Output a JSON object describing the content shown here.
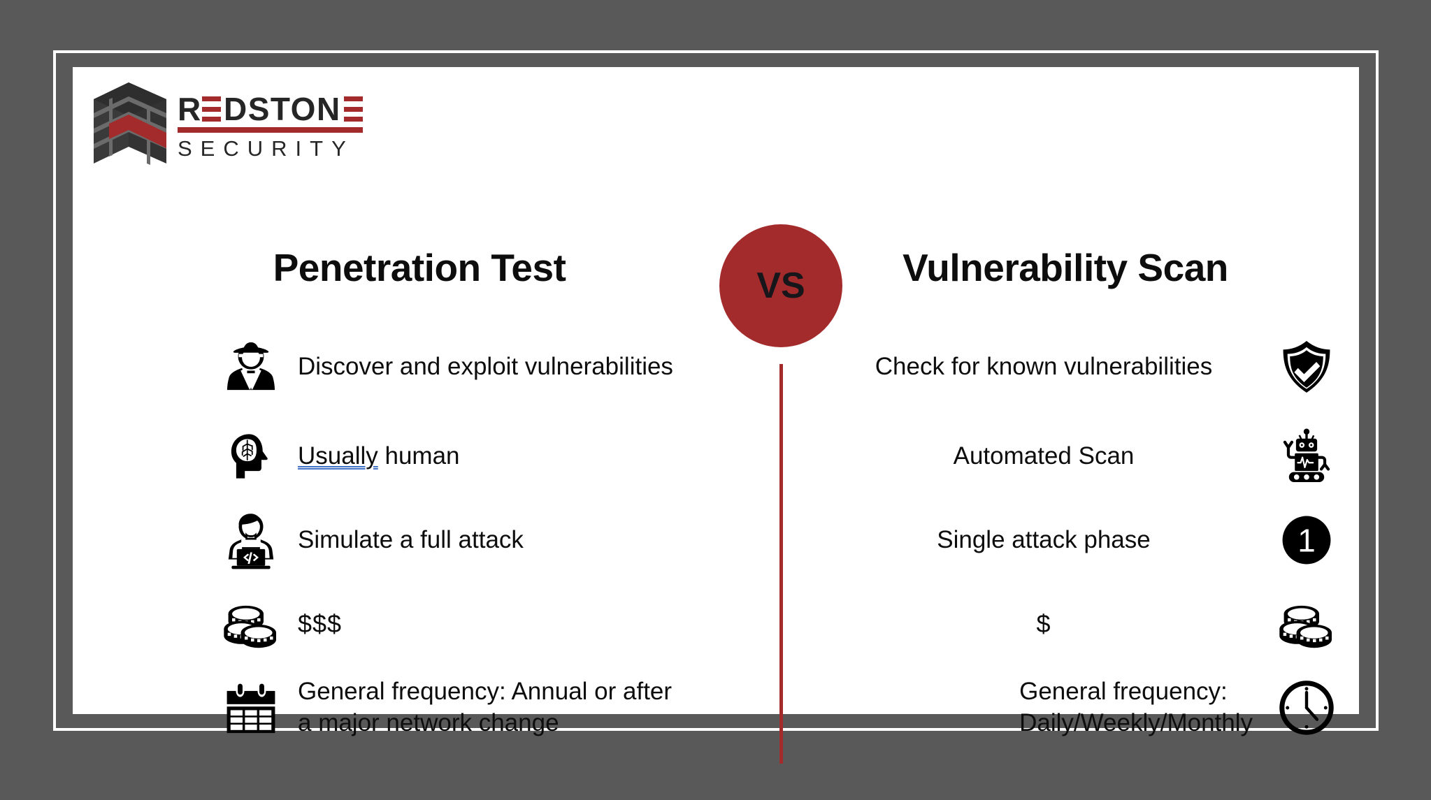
{
  "brand": {
    "name_primary": "REDSTONE",
    "name_secondary": "SECURITY",
    "accent_color": "#A32B2B",
    "dark_color": "#333333",
    "logo_icon": "brick-cube-logo"
  },
  "theme": {
    "background": "#595959",
    "card": "#FFFFFF",
    "frame_border": "#FFFFFF",
    "accent_red": "#A32B2B",
    "text_dark": "#0D0D0D",
    "spellcheck_underline": "#4472C4"
  },
  "center": {
    "vs_label": "VS",
    "badge_color": "#A32B2B",
    "divider_color": "#A32B2B"
  },
  "columns": {
    "left": {
      "title": "Penetration Test",
      "rows": [
        {
          "icon": "spy-detective-icon",
          "text": "Discover and exploit vulnerabilities"
        },
        {
          "icon": "brain-head-icon",
          "text_flagged": "Usually",
          "text_rest": " human"
        },
        {
          "icon": "hacker-laptop-icon",
          "text": "Simulate a full attack"
        },
        {
          "icon": "coins-stack-icon",
          "text": "$$$"
        },
        {
          "icon": "calendar-icon",
          "text_line1": "General frequency: Annual or after",
          "text_line2": "a major network change"
        }
      ]
    },
    "right": {
      "title": "Vulnerability Scan",
      "rows": [
        {
          "icon": "shield-check-icon",
          "text": "Check for known vulnerabilities"
        },
        {
          "icon": "robot-icon",
          "text": "Automated Scan"
        },
        {
          "icon": "number-one-circle-icon",
          "text": "Single attack phase"
        },
        {
          "icon": "coins-stack-icon",
          "text": "$"
        },
        {
          "icon": "clock-icon",
          "text_line1": "General frequency:",
          "text_line2": "Daily/Weekly/Monthly"
        }
      ]
    }
  }
}
